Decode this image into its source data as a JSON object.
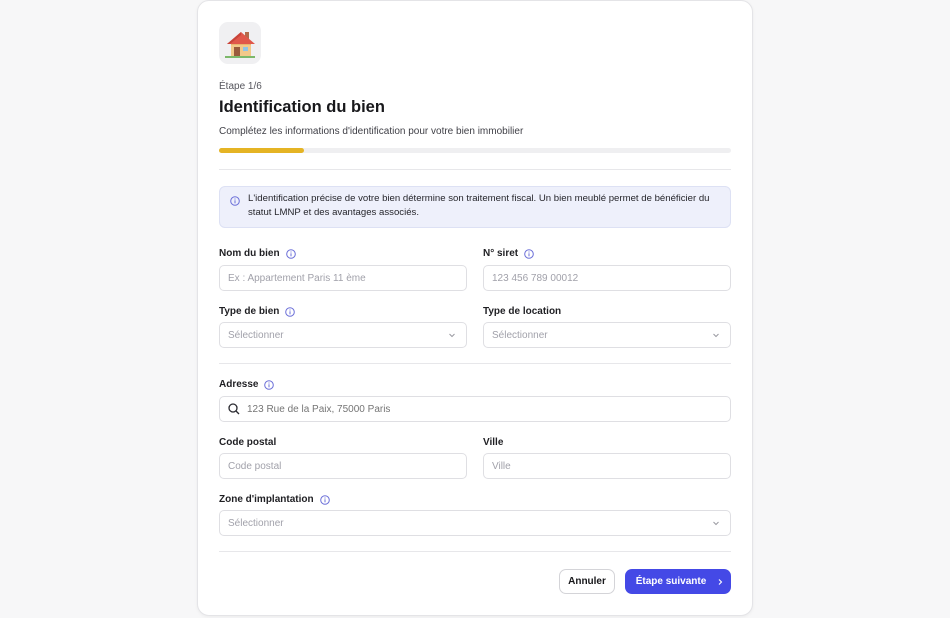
{
  "header": {
    "icon": "house-icon",
    "step": "Étape 1/6",
    "title": "Identification du bien",
    "subtitle": "Complétez les informations d'identification pour votre bien immobilier"
  },
  "progress": {
    "current_step": 1,
    "total_steps": 6,
    "fraction": 0.1667,
    "color": "#e5b424"
  },
  "notice": {
    "icon": "info-icon",
    "text": "L'identification précise de votre bien détermine son traitement fiscal. Un bien meublé permet de bénéficier du statut LMNP et des avantages associés."
  },
  "form": {
    "nom_bien": {
      "label": "Nom du bien",
      "placeholder": "Ex : Appartement Paris 11 ème",
      "value": ""
    },
    "siret": {
      "label": "N° siret",
      "placeholder": "123 456 789 00012",
      "value": ""
    },
    "type_bien": {
      "label": "Type de bien",
      "selected": "Sélectionner"
    },
    "type_location": {
      "label": "Type de location",
      "selected": "Sélectionner"
    },
    "adresse": {
      "label": "Adresse",
      "placeholder": "123 Rue de la Paix, 75000 Paris",
      "value": ""
    },
    "code_postal": {
      "label": "Code postal",
      "placeholder": "Code postal",
      "value": ""
    },
    "ville": {
      "label": "Ville",
      "placeholder": "Ville",
      "value": ""
    },
    "zone": {
      "label": "Zone d'implantation",
      "selected": "Sélectionner"
    }
  },
  "actions": {
    "cancel_label": "Annuler",
    "next_label": "Étape suivante",
    "next_icon": "chevron-right-icon"
  },
  "colors": {
    "accent": "#4449e6",
    "progress": "#e5b424",
    "notice_bg": "#eef0fb",
    "info_icon": "#6b6fd8"
  }
}
